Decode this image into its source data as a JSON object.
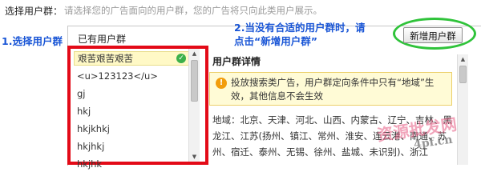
{
  "top": {
    "label": "选择用户群：",
    "hint": "请选择您的广告面向的用户群，您的广告将只向此类用户展示。"
  },
  "annotations": {
    "step1": "1.选择用户群",
    "step2_line1": "2.当没有合适的用户群时，请",
    "step2_line2": "点击“新增用户群”"
  },
  "dialog": {
    "existing_title": "已有用户群",
    "add_button": "新增用户群",
    "groups": [
      {
        "label": "艰苦艰苦艰苦",
        "selected": true
      },
      {
        "label": "<u>123123</u>",
        "selected": false
      },
      {
        "label": "gj",
        "selected": false
      },
      {
        "label": "hkj",
        "selected": false
      },
      {
        "label": "hkjkhkj",
        "selected": false
      },
      {
        "label": "hkjhkj",
        "selected": false
      },
      {
        "label": "hkjhk",
        "selected": false
      }
    ],
    "detail_title": "用户群详情",
    "notice": "投放搜索类广告，用户群定向条件中只有“地域”生效，其他信息不会生效",
    "regions_line1": "地域：北京、天津、河北、山西、内蒙古、辽宁、吉林、黑",
    "regions_line2": "龙江、江苏(扬州、镇江、常州、淮安、连云港、南通、苏",
    "regions_line3": "州、宿迁、泰州、无锡、徐州、盐城、未识别)、浙江"
  },
  "watermark": {
    "text": "资源批发网",
    "url": "4pf.cn"
  },
  "colors": {
    "annotation_blue": "#1a56d6",
    "highlight_red": "#e30a17",
    "highlight_green": "#2fc33a",
    "notice_bg": "#fffbd6"
  }
}
